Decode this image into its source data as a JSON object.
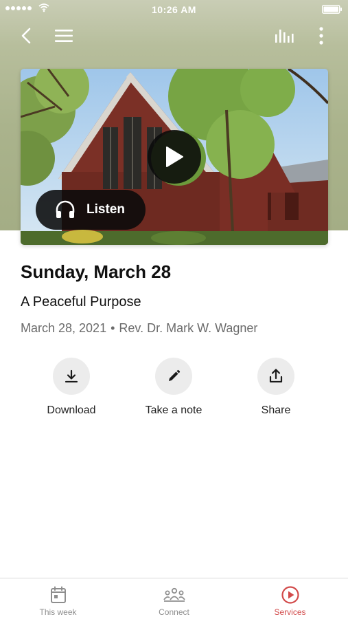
{
  "status_bar": {
    "time": "10:26 AM"
  },
  "nav": {
    "back_icon": "chevron-left-icon",
    "menu_icon": "hamburger-menu-icon",
    "audio_icon": "audio-bars-icon",
    "more_icon": "more-vertical-icon"
  },
  "media": {
    "play_icon": "play-icon",
    "listen_label": "Listen",
    "listen_icon": "headphones-icon"
  },
  "sermon": {
    "title": "Sunday, March 28",
    "subtitle": "A Peaceful Purpose",
    "date": "March 28, 2021",
    "separator": "•",
    "speaker": "Rev. Dr. Mark W. Wagner"
  },
  "actions": [
    {
      "label": "Download",
      "icon": "download-icon"
    },
    {
      "label": "Take a note",
      "icon": "pencil-icon"
    },
    {
      "label": "Share",
      "icon": "share-icon"
    }
  ],
  "tabs": [
    {
      "label": "This week",
      "icon": "calendar-icon",
      "active": false
    },
    {
      "label": "Connect",
      "icon": "people-icon",
      "active": false
    },
    {
      "label": "Services",
      "icon": "play-circle-icon",
      "active": true
    }
  ],
  "colors": {
    "accent": "#d24b4b",
    "header_background": "#aab38c",
    "action_circle": "#ececec",
    "tab_inactive": "#8e8e8e"
  }
}
